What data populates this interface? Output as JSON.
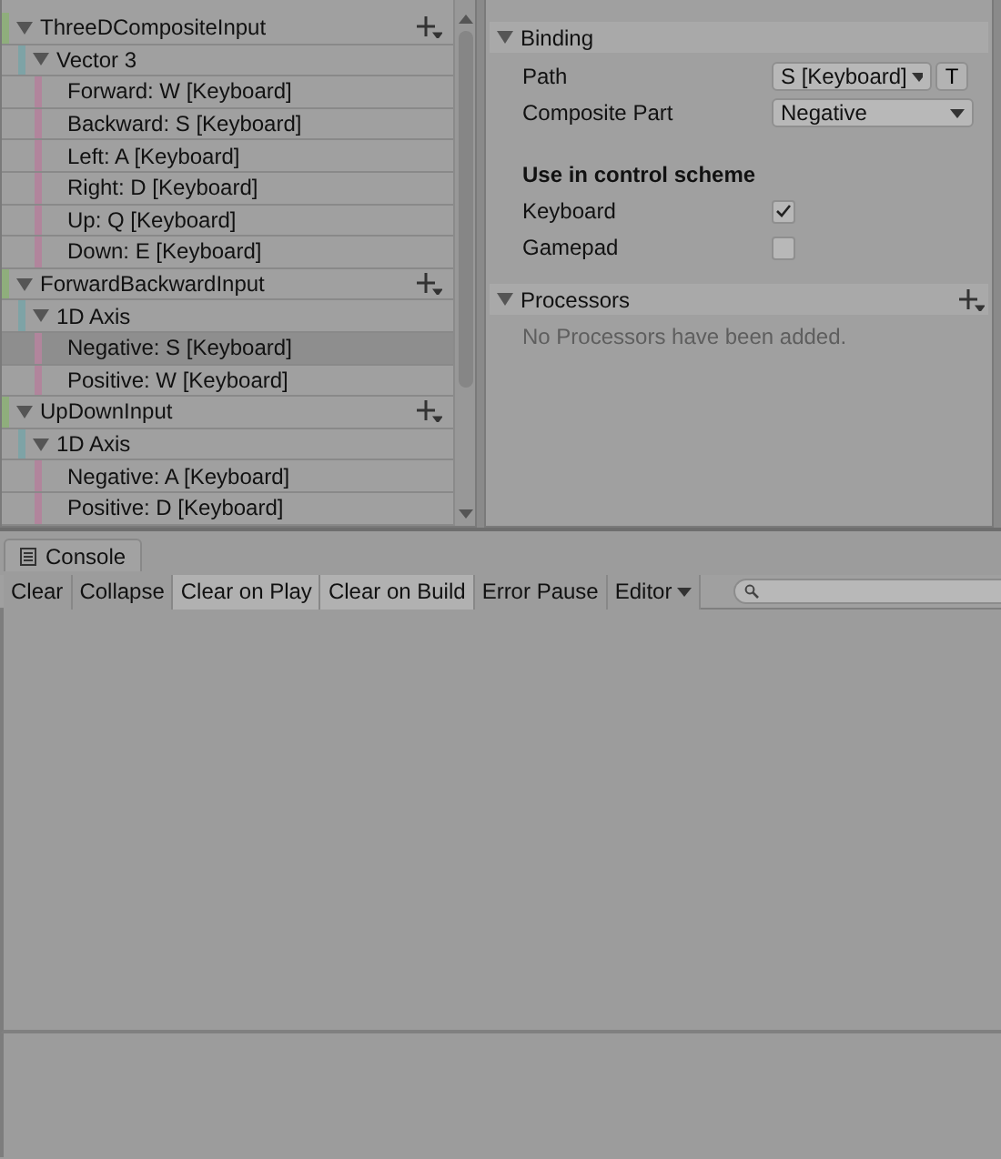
{
  "actions": [
    {
      "name": "ThreeDCompositeInput",
      "color": "#8fae7c",
      "expanded": true,
      "selected": false,
      "children": [
        {
          "name": "Vector 3",
          "color": "#7ea3a6",
          "expanded": true,
          "selected": false,
          "children": [
            {
              "name": "Forward: W [Keyboard]",
              "color": "#b1859c",
              "selected": false
            },
            {
              "name": "Backward: S [Keyboard]",
              "color": "#b1859c",
              "selected": false
            },
            {
              "name": "Left: A [Keyboard]",
              "color": "#b1859c",
              "selected": false
            },
            {
              "name": "Right: D [Keyboard]",
              "color": "#b1859c",
              "selected": false
            },
            {
              "name": "Up: Q [Keyboard]",
              "color": "#b1859c",
              "selected": false
            },
            {
              "name": "Down: E [Keyboard]",
              "color": "#b1859c",
              "selected": false
            }
          ]
        }
      ]
    },
    {
      "name": "ForwardBackwardInput",
      "color": "#8fae7c",
      "expanded": true,
      "selected": false,
      "children": [
        {
          "name": "1D Axis",
          "color": "#7ea3a6",
          "expanded": true,
          "selected": false,
          "children": [
            {
              "name": "Negative: S [Keyboard]",
              "color": "#b1859c",
              "selected": true
            },
            {
              "name": "Positive: W [Keyboard]",
              "color": "#b1859c",
              "selected": false
            }
          ]
        }
      ]
    },
    {
      "name": "UpDownInput",
      "color": "#8fae7c",
      "expanded": true,
      "selected": false,
      "children": [
        {
          "name": "1D Axis",
          "color": "#7ea3a6",
          "expanded": true,
          "selected": false,
          "children": [
            {
              "name": "Negative: A [Keyboard]",
              "color": "#b1859c",
              "selected": false
            },
            {
              "name": "Positive: D [Keyboard]",
              "color": "#b1859c",
              "selected": false
            }
          ]
        }
      ]
    }
  ],
  "properties": {
    "binding": {
      "title": "Binding",
      "expanded": true,
      "path": {
        "label": "Path",
        "value": "S [Keyboard]",
        "t_button": "T"
      },
      "composite_part": {
        "label": "Composite Part",
        "value": "Negative"
      },
      "scheme_heading": "Use in control scheme",
      "schemes": [
        {
          "label": "Keyboard",
          "checked": true
        },
        {
          "label": "Gamepad",
          "checked": false
        }
      ]
    },
    "processors": {
      "title": "Processors",
      "expanded": true,
      "empty_message": "No Processors have been added."
    }
  },
  "console": {
    "tab": "Console",
    "toolbar": [
      {
        "label": "Clear",
        "kind": "button",
        "on": false
      },
      {
        "label": "Collapse",
        "kind": "toggle",
        "on": false
      },
      {
        "label": "Clear on Play",
        "kind": "toggle",
        "on": true
      },
      {
        "label": "Clear on Build",
        "kind": "toggle",
        "on": true
      },
      {
        "label": "Error Pause",
        "kind": "toggle",
        "on": false
      },
      {
        "label": "Editor",
        "kind": "dropdown",
        "on": false
      }
    ]
  }
}
